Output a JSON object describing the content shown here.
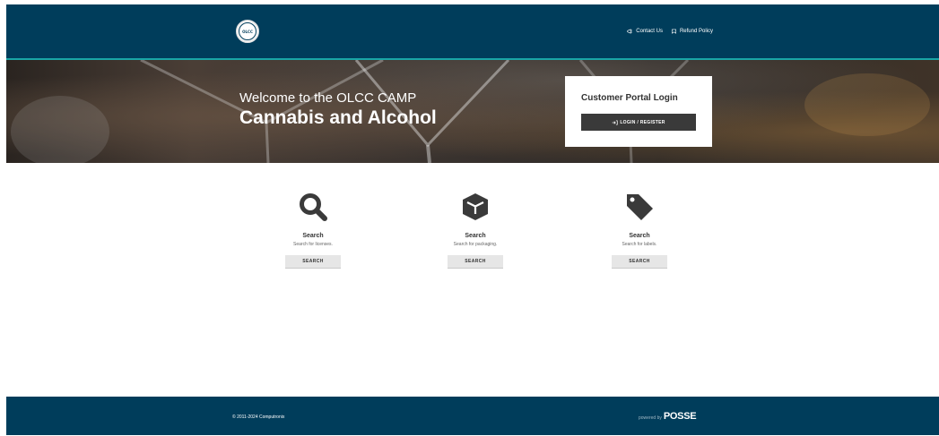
{
  "header": {
    "logo_text": "OLCC",
    "nav": [
      {
        "label": "Contact Us",
        "icon": "megaphone-icon"
      },
      {
        "label": "Refund Policy",
        "icon": "bookmark-icon"
      }
    ]
  },
  "hero": {
    "welcome": "Welcome to the OLCC CAMP",
    "title": "Cannabis and Alcohol",
    "login_title": "Customer Portal Login",
    "login_button": "LOGIN / REGISTER"
  },
  "cards": [
    {
      "icon": "magnifier-icon",
      "title": "Search",
      "description": "Search for licenses.",
      "button": "SEARCH"
    },
    {
      "icon": "box-icon",
      "title": "Search",
      "description": "Search for packaging.",
      "button": "SEARCH"
    },
    {
      "icon": "tag-icon",
      "title": "Search",
      "description": "Search for labels.",
      "button": "SEARCH"
    }
  ],
  "footer": {
    "copyright": "© 2011-2024 Computronix",
    "powered_by": "powered by",
    "brand": "POSSE"
  },
  "colors": {
    "header_bg": "#003d5b",
    "accent_line": "#19a6a6",
    "button_dark": "#3a3a3a",
    "button_light": "#e6e6e6"
  }
}
